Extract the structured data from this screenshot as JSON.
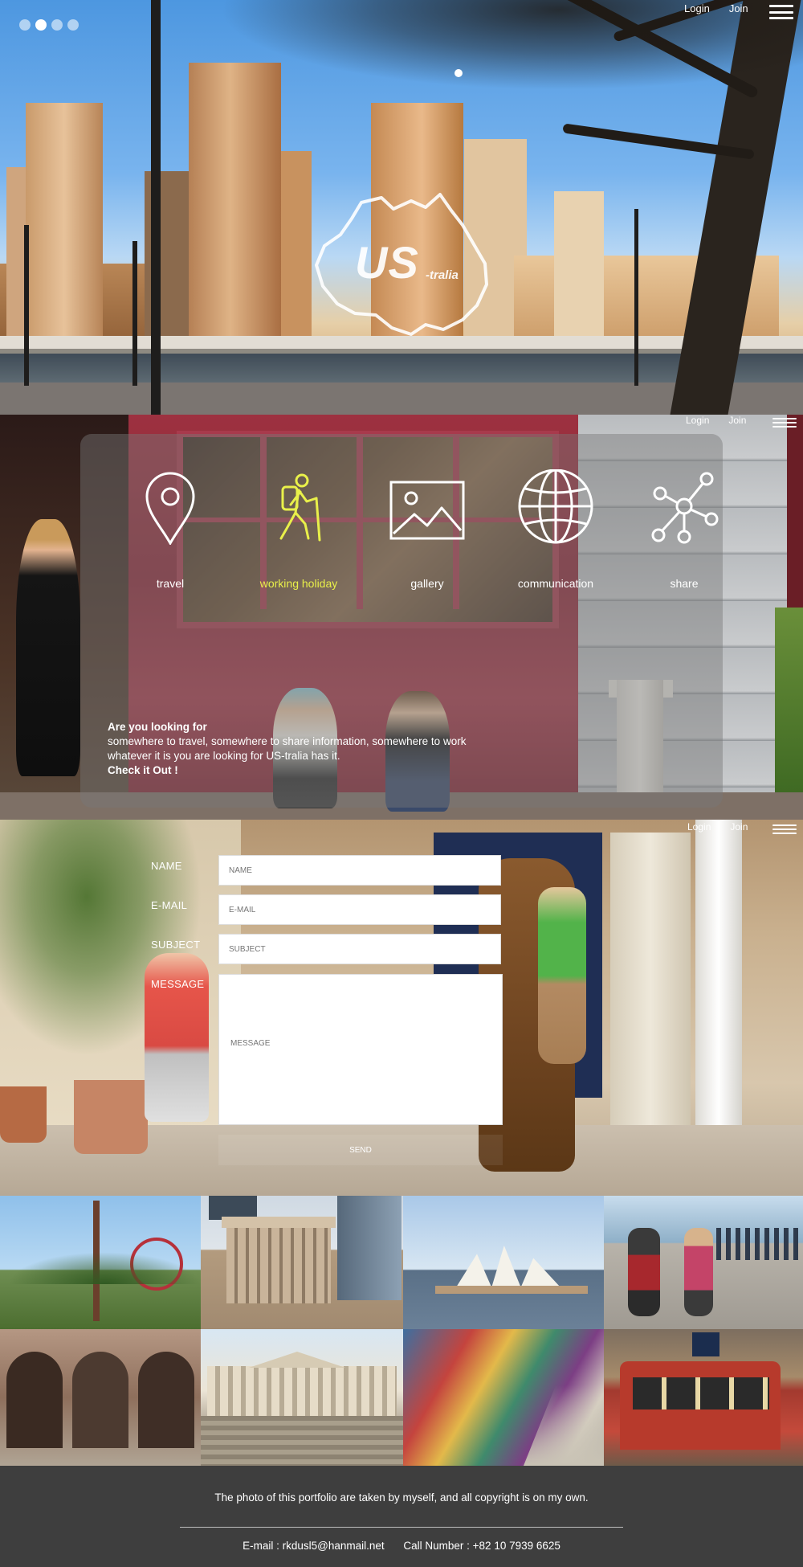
{
  "header": {
    "login_label": "Login",
    "join_label": "Join",
    "menu_icon": "hamburger-icon",
    "slider_dots": 4,
    "active_dot": 1
  },
  "hero": {
    "logo_text": "US",
    "logo_suffix": "-tralia"
  },
  "nav": {
    "items": [
      {
        "label": "travel",
        "icon": "location-pin-icon"
      },
      {
        "label": "working holiday",
        "icon": "hiker-icon",
        "active": true
      },
      {
        "label": "gallery",
        "icon": "image-icon"
      },
      {
        "label": "communication",
        "icon": "globe-icon"
      },
      {
        "label": "share",
        "icon": "share-network-icon"
      }
    ],
    "active_color": "#e9f04a"
  },
  "intro": {
    "heading": "Are you looking for",
    "line1": "somewhere to travel, somewhere to share information, somewhere to work",
    "line2": "whatever it is you are looking for US-tralia has it.",
    "cta": "Check it Out !"
  },
  "contact": {
    "name_label": "NAME",
    "email_label": "E-MAIL",
    "subject_label": "SUBJECT",
    "message_label": "MESSAGE",
    "name_placeholder": "NAME",
    "email_placeholder": "E-MAIL",
    "subject_placeholder": "SUBJECT",
    "message_placeholder": "MESSAGE",
    "send_label": "SEND"
  },
  "footer": {
    "note": "The photo of this portfolio are taken by myself, and all copyright is on my own.",
    "email": "E-mail : rkdusl5@hanmail.net",
    "phone": "Call Number : +82 10 7939 6625",
    "background": "#3e3e3e"
  }
}
